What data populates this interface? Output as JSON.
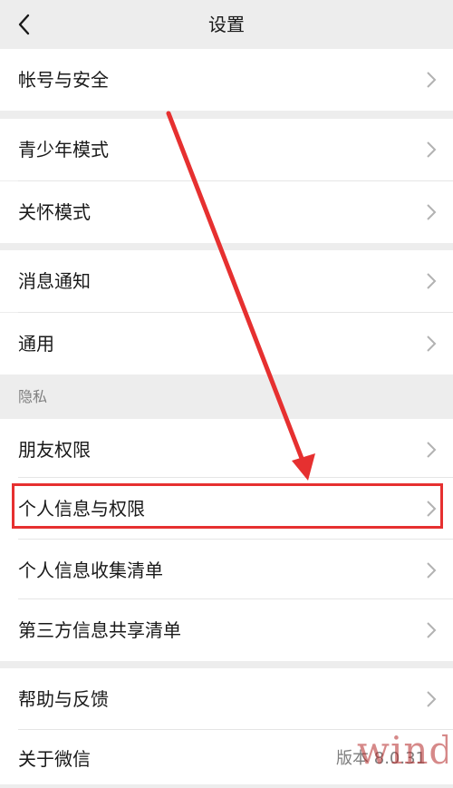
{
  "nav": {
    "title": "设置",
    "back_icon": "chevron-left-icon"
  },
  "groups": [
    {
      "items": [
        {
          "label": "帐号与安全"
        }
      ]
    },
    {
      "items": [
        {
          "label": "青少年模式"
        },
        {
          "label": "关怀模式"
        }
      ]
    },
    {
      "items": [
        {
          "label": "消息通知"
        },
        {
          "label": "通用"
        }
      ]
    },
    {
      "header": "隐私",
      "items": [
        {
          "label": "朋友权限"
        },
        {
          "label": "个人信息与权限"
        },
        {
          "label": "个人信息收集清单"
        },
        {
          "label": "第三方信息共享清单"
        }
      ]
    },
    {
      "items": [
        {
          "label": "帮助与反馈"
        },
        {
          "label": "关于微信",
          "value": "版本 8.0.31"
        }
      ]
    }
  ],
  "overlay": {
    "watermark": "wind",
    "annotation_color": "#e63030"
  },
  "colors": {
    "background": "#ededed",
    "row": "#ffffff",
    "secondary_text": "#7f7f7f"
  }
}
